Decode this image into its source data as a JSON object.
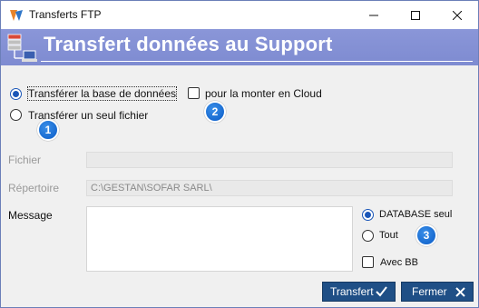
{
  "window": {
    "title": "Transferts FTP"
  },
  "banner": {
    "title": "Transfert données au Support"
  },
  "options": {
    "transfer_db": "Transférer la base de données",
    "transfer_file": "Transférer un seul fichier",
    "cloud": "pour la monter en Cloud",
    "selected": "transfer_db"
  },
  "badges": [
    "1",
    "2",
    "3"
  ],
  "form": {
    "fichier_label": "Fichier",
    "fichier_value": "",
    "repertoire_label": "Répertoire",
    "repertoire_value": "C:\\GESTAN\\SOFAR SARL\\",
    "message_label": "Message"
  },
  "scope": {
    "database_only": "DATABASE seul",
    "all": "Tout",
    "with_bb": "Avec BB",
    "selected": "database_only"
  },
  "buttons": {
    "transfer": "Transfert",
    "close": "Fermer"
  },
  "colors": {
    "banner": "#7e8bd1",
    "button": "#1f4f86",
    "radio_accent": "#1a56b8",
    "badge": "#0a5bc7"
  }
}
